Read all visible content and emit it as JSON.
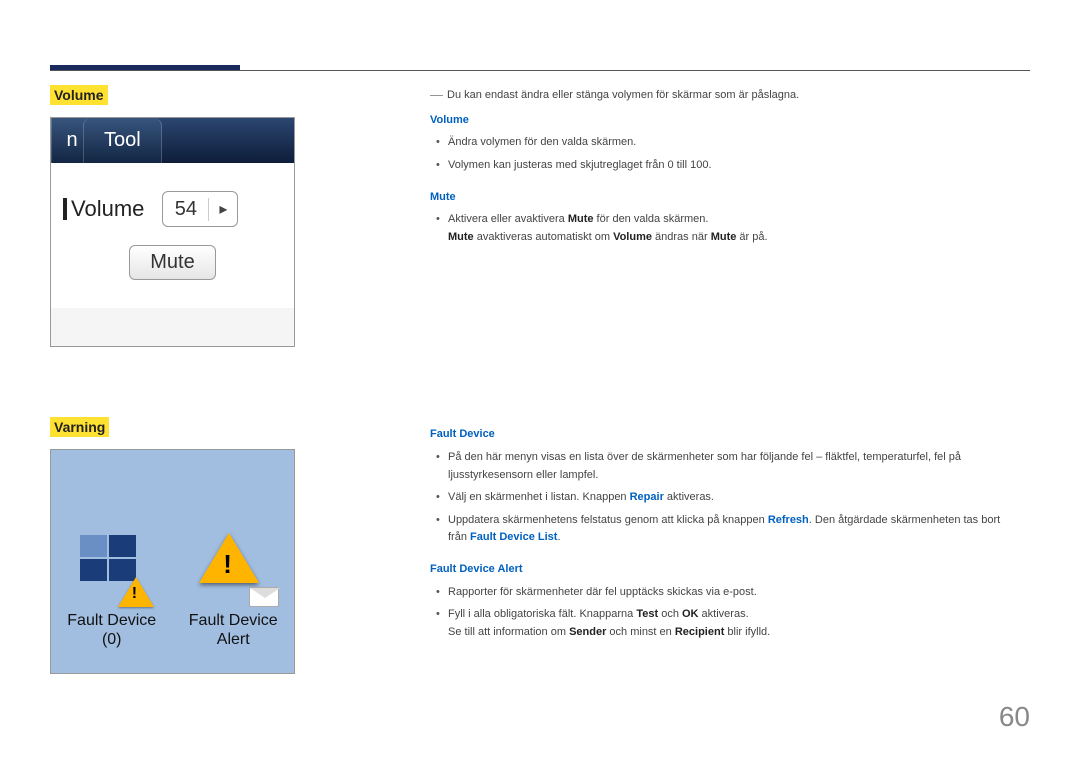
{
  "page_number": "60",
  "volume_section": {
    "title": "Volume",
    "tool_tab": "Tool",
    "tab_left": "n",
    "volume_label": "Volume",
    "volume_value": "54",
    "mute_button": "Mute",
    "note": "Du kan endast ändra eller stänga volymen för skärmar som är påslagna.",
    "sub_volume_head": "Volume",
    "sub_volume_items": {
      "a": "Ändra volymen för den valda skärmen.",
      "b": "Volymen kan justeras med skjutreglaget från 0 till 100."
    },
    "sub_mute_head": "Mute",
    "mute_item_pre": "Aktivera eller avaktivera ",
    "mute_item_bold": "Mute",
    "mute_item_post": " för den valda skärmen.",
    "mute_note_1": "Mute",
    "mute_note_2": " avaktiveras automatiskt om ",
    "mute_note_3": "Volume",
    "mute_note_4": " ändras när ",
    "mute_note_5": "Mute",
    "mute_note_6": " är på."
  },
  "varning_section": {
    "title": "Varning",
    "fault_device_label_1": "Fault Device",
    "fault_device_label_2": "(0)",
    "fault_alert_label_1": "Fault Device",
    "fault_alert_label_2": "Alert",
    "fd_head": "Fault Device",
    "fd_item1": "På den här menyn visas en lista över de skärmenheter som har följande fel – fläktfel, temperaturfel, fel på ljusstyrkesensorn eller lampfel.",
    "fd_item2_pre": "Välj en skärmenhet i listan. Knappen ",
    "fd_item2_bold": "Repair",
    "fd_item2_post": " aktiveras.",
    "fd_item3_pre": "Uppdatera skärmenhetens felstatus genom att klicka på knappen ",
    "fd_item3_bold": "Refresh",
    "fd_item3_mid": ". Den åtgärdade skärmenheten tas bort från ",
    "fd_item3_list": "Fault Device List",
    "fd_item3_end": ".",
    "fda_head": "Fault Device Alert",
    "fda_item1": "Rapporter för skärmenheter där fel upptäcks skickas via e-post.",
    "fda_item2_pre": "Fyll i alla obligatoriska fält. Knapparna ",
    "fda_item2_b1": "Test",
    "fda_item2_mid": " och ",
    "fda_item2_b2": "OK",
    "fda_item2_post": " aktiveras.",
    "fda_item3_pre": "Se till att information om ",
    "fda_item3_b1": "Sender",
    "fda_item3_mid": " och minst en ",
    "fda_item3_b2": "Recipient",
    "fda_item3_post": " blir ifylld."
  }
}
